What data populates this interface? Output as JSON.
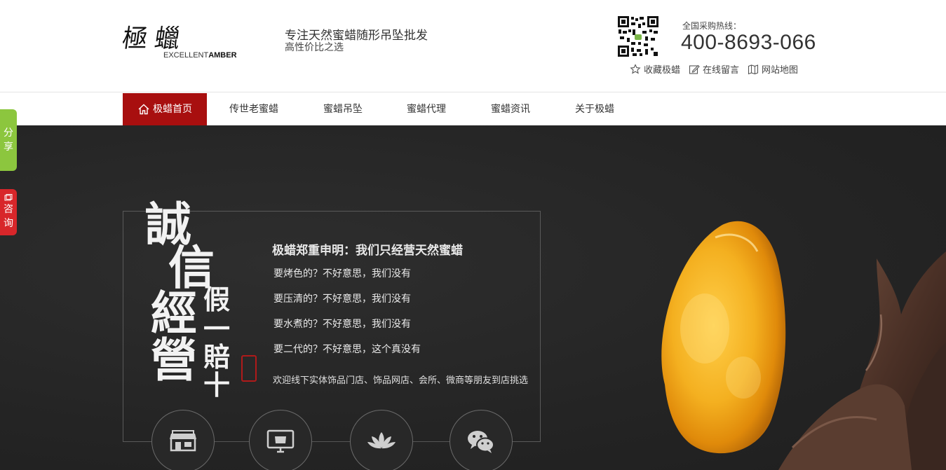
{
  "header": {
    "logo_cn": "極蠟",
    "logo_en_light": "EXCELLENT",
    "logo_en_bold": "AMBER",
    "slogan_main": "专注天然蜜蜡随形吊坠批发",
    "slogan_sub": "高性价比之选",
    "hotline_label": "全国采购热线：",
    "hotline_number": "400-8693-066",
    "links": [
      {
        "label": "收藏极蜡",
        "icon": "star-icon"
      },
      {
        "label": "在线留言",
        "icon": "edit-icon"
      },
      {
        "label": "网站地图",
        "icon": "map-icon"
      }
    ]
  },
  "nav": {
    "items": [
      {
        "label": "极蜡首页",
        "active": true
      },
      {
        "label": "传世老蜜蜡",
        "active": false
      },
      {
        "label": "蜜蜡吊坠",
        "active": false
      },
      {
        "label": "蜜蜡代理",
        "active": false
      },
      {
        "label": "蜜蜡资讯",
        "active": false
      },
      {
        "label": "关于极蜡",
        "active": false
      }
    ],
    "active_color": "#a80f0f"
  },
  "banner": {
    "big_text": [
      "誠",
      "信",
      "經",
      "營"
    ],
    "small_text": [
      "假",
      "一",
      "賠",
      "十"
    ],
    "statement": "极蜡郑重申明：我们只经营天然蜜蜡",
    "lines": [
      "要烤色的？不好意思，我们没有",
      "要压清的？不好意思，我们没有",
      "要水煮的？不好意思，我们没有",
      "要二代的？不好意思，这个真没有"
    ],
    "invite": "欢迎线下实体饰品门店、饰品网店、会所、微商等朋友到店挑选",
    "circle_icons": [
      "store-icon",
      "monitor-icon",
      "lotus-icon",
      "wechat-icon"
    ]
  },
  "side": {
    "share": "分享",
    "consult": "咨询",
    "share_color": "#8cc63e",
    "consult_color": "#d8262a"
  }
}
